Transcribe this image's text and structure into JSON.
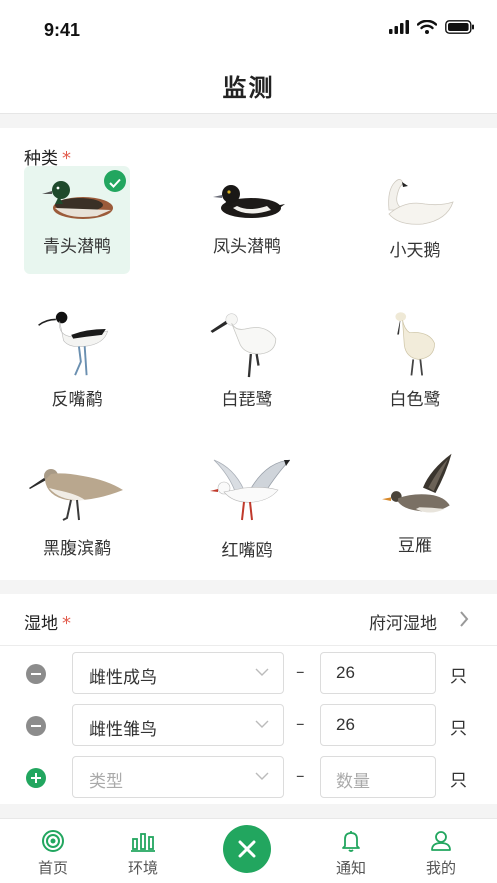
{
  "status_bar": {
    "time": "9:41"
  },
  "header": {
    "title": "监测"
  },
  "species_section": {
    "label": "种类",
    "required_mark": "*",
    "selected_index": 0,
    "birds": [
      {
        "name": "青头潜鸭",
        "icon": "diving-duck-icon"
      },
      {
        "name": "凤头潜鸭",
        "icon": "tufted-duck-icon"
      },
      {
        "name": "小天鹅",
        "icon": "swan-icon"
      },
      {
        "name": "反嘴鹬",
        "icon": "avocet-icon"
      },
      {
        "name": "白琵鹭",
        "icon": "spoonbill-icon"
      },
      {
        "name": "白色鹭",
        "icon": "white-egret-icon"
      },
      {
        "name": "黑腹滨鹬",
        "icon": "dunlin-icon"
      },
      {
        "name": "红嘴鸥",
        "icon": "gull-icon"
      },
      {
        "name": "豆雁",
        "icon": "goose-icon"
      }
    ]
  },
  "wetland_section": {
    "label": "湿地",
    "required_mark": "*",
    "value": "府河湿地",
    "entries": [
      {
        "action": "remove",
        "type": "雌性成鸟",
        "type_placeholder": "",
        "count": "26",
        "count_placeholder": "",
        "unit": "只"
      },
      {
        "action": "remove",
        "type": "雌性雏鸟",
        "type_placeholder": "",
        "count": "26",
        "count_placeholder": "",
        "unit": "只"
      },
      {
        "action": "add",
        "type": "",
        "type_placeholder": "类型",
        "count": "",
        "count_placeholder": "数量",
        "unit": "只"
      }
    ]
  },
  "tab_bar": {
    "tabs": [
      {
        "label": "首页",
        "icon": "target-icon"
      },
      {
        "label": "环境",
        "icon": "bar-chart-icon"
      },
      {
        "label": "通知",
        "icon": "bell-icon"
      },
      {
        "label": "我的",
        "icon": "user-icon"
      }
    ],
    "fab_icon": "close-icon"
  },
  "colors": {
    "accent": "#22a65f",
    "required": "#e25c4d",
    "selected_bg": "#e8f6ef"
  }
}
